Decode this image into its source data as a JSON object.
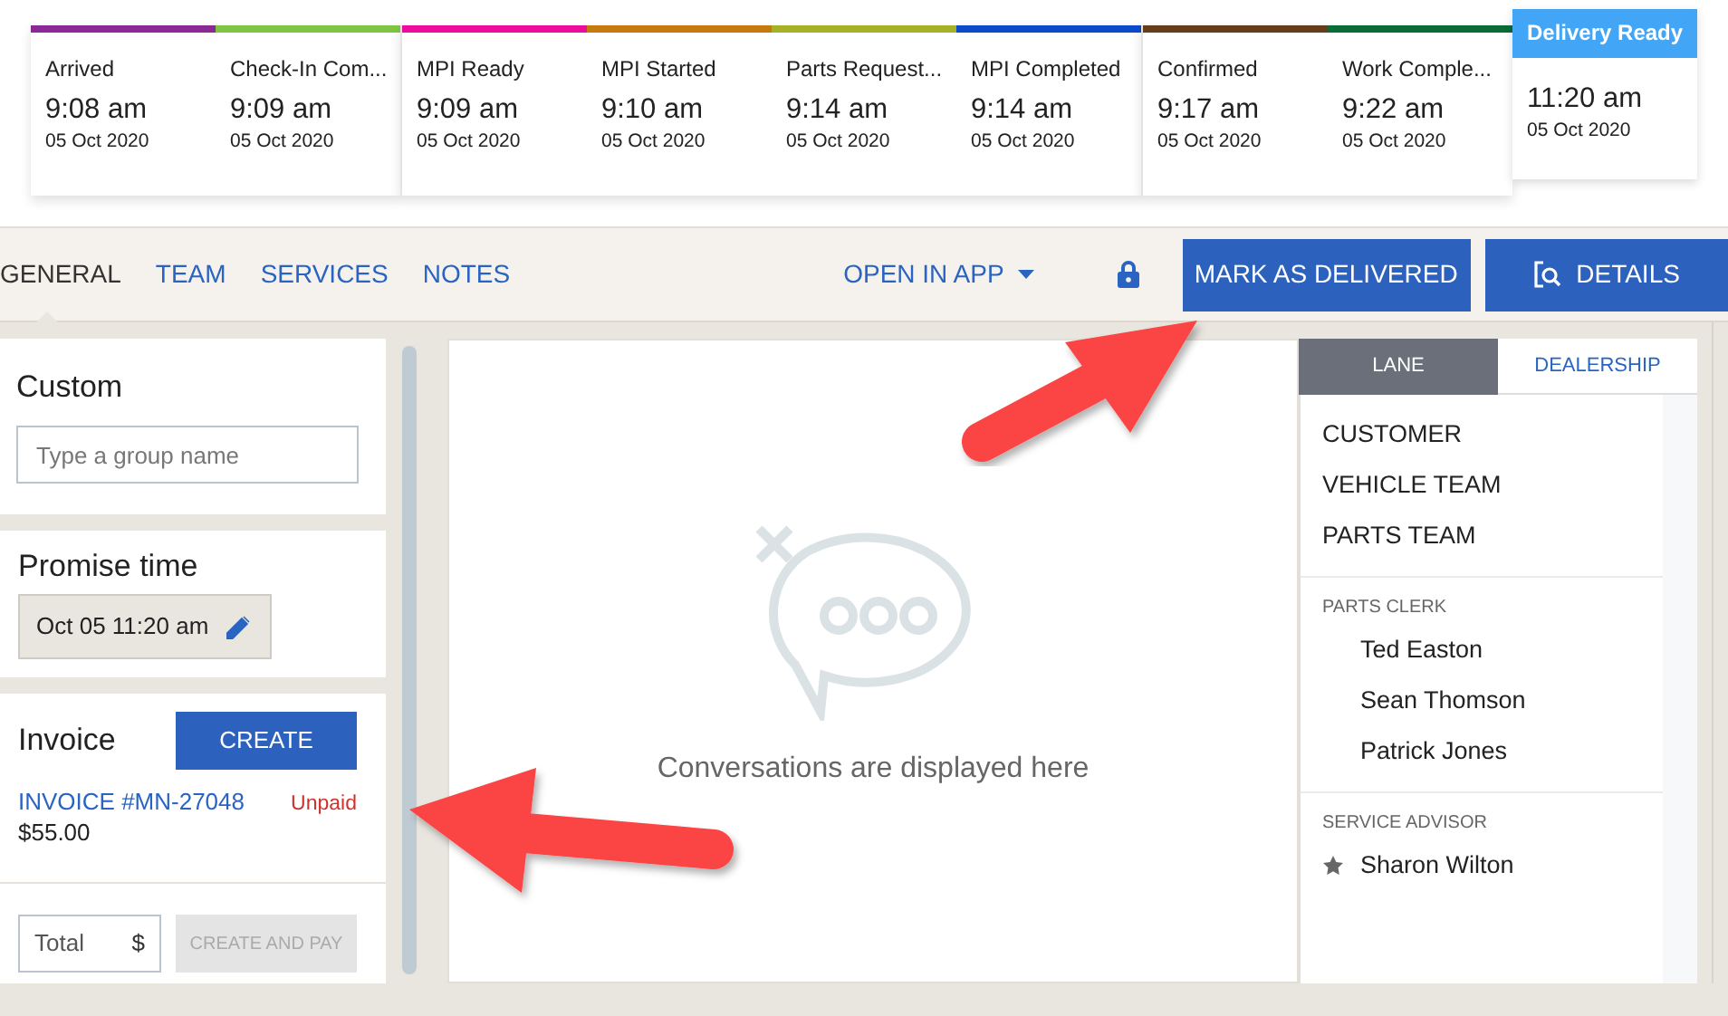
{
  "timeline": {
    "groups": [
      {
        "stages": [
          {
            "label": "Arrived",
            "time": "9:08 am",
            "date": "05 Oct 2020",
            "color": "#8b2a96"
          },
          {
            "label": "Check-In Com...",
            "time": "9:09 am",
            "date": "05 Oct 2020",
            "color": "#7dc642"
          }
        ]
      },
      {
        "stages": [
          {
            "label": "MPI Ready",
            "time": "9:09 am",
            "date": "05 Oct 2020",
            "color": "#ec0d9c"
          },
          {
            "label": "MPI Started",
            "time": "9:10 am",
            "date": "05 Oct 2020",
            "color": "#c47a0c"
          },
          {
            "label": "Parts Request...",
            "time": "9:14 am",
            "date": "05 Oct 2020",
            "color": "#a5b226"
          },
          {
            "label": "MPI Completed",
            "time": "9:14 am",
            "date": "05 Oct 2020",
            "color": "#0c4ac9"
          }
        ]
      },
      {
        "stages": [
          {
            "label": "Confirmed",
            "time": "9:17 am",
            "date": "05 Oct 2020",
            "color": "#653d1b"
          },
          {
            "label": "Work Comple...",
            "time": "9:22 am",
            "date": "05 Oct 2020",
            "color": "#0a6b37"
          }
        ]
      }
    ],
    "current": {
      "label": "Delivery Ready",
      "time": "11:20 am",
      "date": "05 Oct 2020"
    }
  },
  "tabs": [
    {
      "label": "GENERAL",
      "selected": true
    },
    {
      "label": "TEAM",
      "selected": false
    },
    {
      "label": "SERVICES",
      "selected": false
    },
    {
      "label": "NOTES",
      "selected": false
    }
  ],
  "open_in_app": "OPEN IN APP",
  "locked": true,
  "buttons": {
    "mark_delivered": "MARK AS DELIVERED",
    "details": "DETAILS"
  },
  "custom": {
    "title": "Custom",
    "placeholder": "Type a group name"
  },
  "promise_time": {
    "title": "Promise time",
    "value": "Oct 05 11:20 am"
  },
  "invoice": {
    "title": "Invoice",
    "create_button": "CREATE",
    "number": "INVOICE #MN-27048",
    "status": "Unpaid",
    "amount": "$55.00",
    "total_placeholder": "Total",
    "currency": "$",
    "pay_button": {
      "label": "CREATE AND PAY",
      "disabled": true
    }
  },
  "conversation": {
    "empty_message": "Conversations are displayed here"
  },
  "team_panel": {
    "tabs": [
      {
        "label": "LANE",
        "selected": true
      },
      {
        "label": "DEALERSHIP",
        "selected": false
      }
    ],
    "sections": [
      {
        "items": [
          {
            "name": "CUSTOMER"
          },
          {
            "name": "VEHICLE TEAM"
          },
          {
            "name": "PARTS TEAM"
          }
        ]
      },
      {
        "heading": "PARTS CLERK",
        "items": [
          {
            "name": "Ted Easton",
            "starred": false
          },
          {
            "name": "Sean Thomson",
            "starred": false
          },
          {
            "name": "Patrick Jones",
            "starred": false
          }
        ]
      },
      {
        "heading": "SERVICE ADVISOR",
        "items": [
          {
            "name": "Sharon Wilton",
            "starred": true
          }
        ]
      }
    ]
  }
}
